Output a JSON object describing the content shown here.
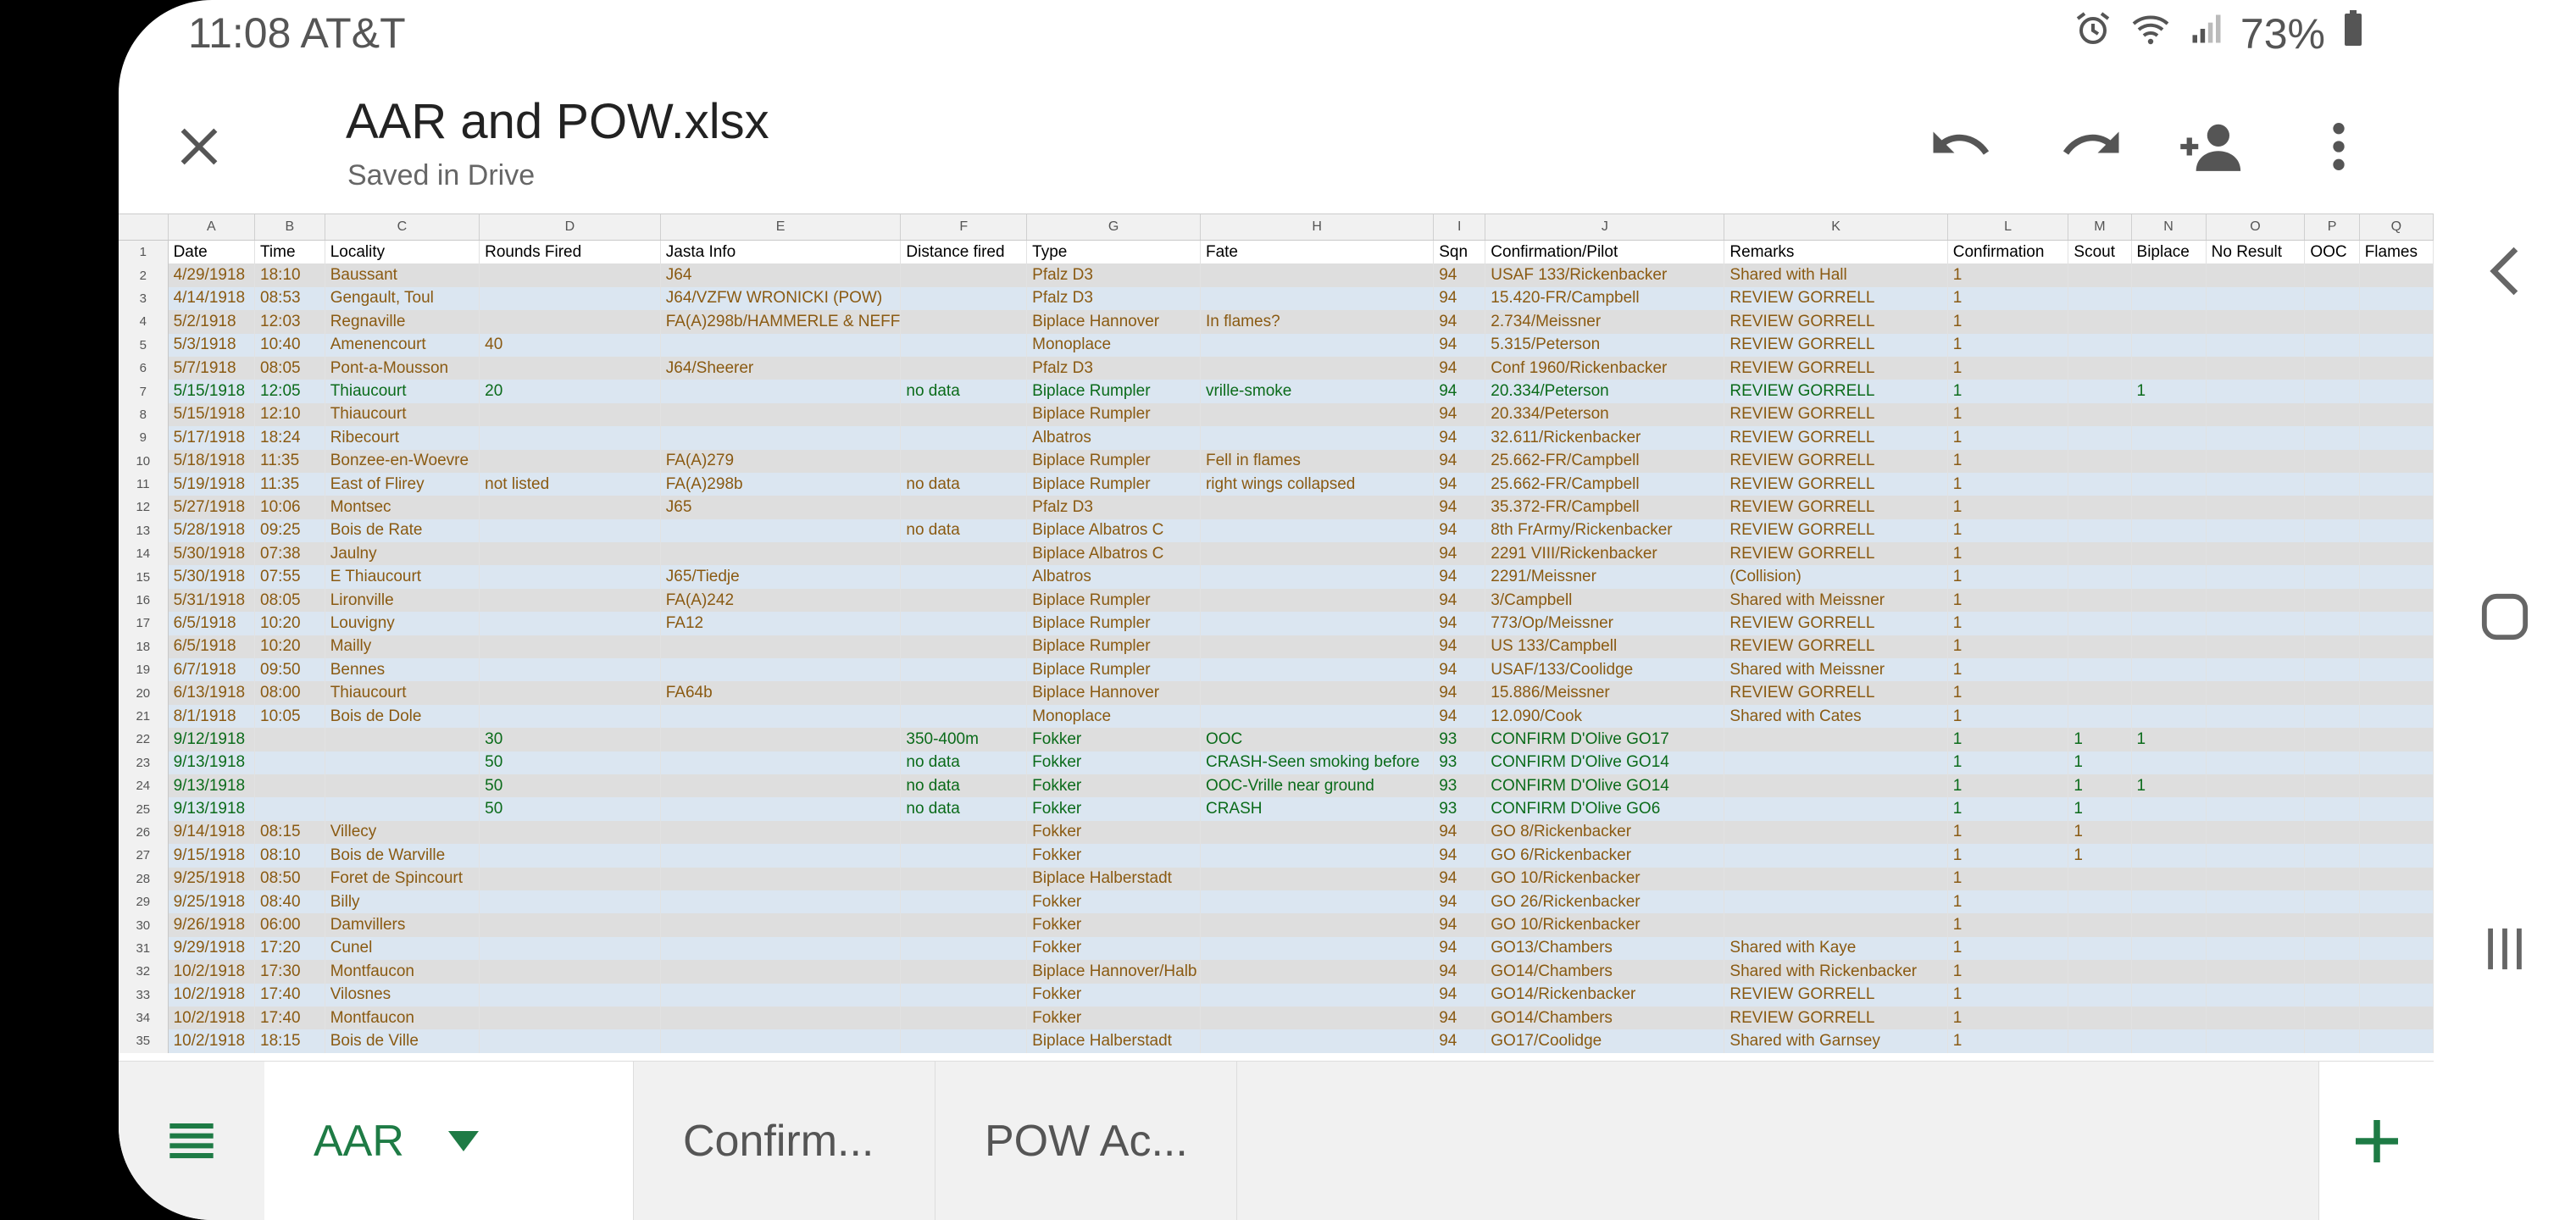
{
  "status_bar": {
    "time": "11:08 AT&T",
    "battery": "73%",
    "icons": [
      "alarm-icon",
      "wifi-icon",
      "signal-icon",
      "battery-icon"
    ]
  },
  "app_bar": {
    "title": "AAR and POW.xlsx",
    "subtitle": "Saved in Drive",
    "icons": [
      "close-icon",
      "undo-icon",
      "redo-icon",
      "share-add-person-icon",
      "more-vert-icon"
    ]
  },
  "colors": {
    "accent_green": "#1e7b45",
    "text_brown": "#8a5a12",
    "text_green": "#0b6b1a",
    "row_gray": "#dedede",
    "row_blue": "#dbe6f1"
  },
  "sheet": {
    "column_letters": [
      "A",
      "B",
      "C",
      "D",
      "E",
      "F",
      "G",
      "H",
      "I",
      "J",
      "K",
      "L",
      "M",
      "N",
      "O",
      "P",
      "Q"
    ],
    "header_row": {
      "number": "1",
      "cells": [
        "Date",
        "Time",
        "Locality",
        "Rounds Fired",
        "Jasta Info",
        "Distance fired",
        "Type",
        "Fate",
        "Sqn",
        "Confirmation/Pilot",
        "Remarks",
        "Confirmation",
        "Scout",
        "Biplace",
        "No Result",
        "OOC",
        "Flames"
      ]
    },
    "rows": [
      {
        "n": "2",
        "style": "gray",
        "color": "brown",
        "cells": [
          "4/29/1918",
          "18:10",
          "Baussant",
          "",
          "J64",
          "",
          "Pfalz D3",
          "",
          "94",
          "USAF 133/Rickenbacker",
          "Shared with Hall",
          "1",
          "",
          "",
          "",
          "",
          ""
        ]
      },
      {
        "n": "3",
        "style": "blue",
        "color": "brown",
        "cells": [
          "4/14/1918",
          "08:53",
          "Gengault, Toul",
          "",
          "J64/VZFW WRONICKI (POW)",
          "",
          "Pfalz D3",
          "",
          "94",
          "15.420-FR/Campbell",
          "REVIEW GORRELL",
          "1",
          "",
          "",
          "",
          "",
          ""
        ]
      },
      {
        "n": "4",
        "style": "gray",
        "color": "brown",
        "cells": [
          "5/2/1918",
          "12:03",
          "Regnaville",
          "",
          "FA(A)298b/HAMMERLE & NEFF",
          "",
          "Biplace Hannover",
          "In flames?",
          "94",
          "2.734/Meissner",
          "REVIEW GORRELL",
          "1",
          "",
          "",
          "",
          "",
          ""
        ]
      },
      {
        "n": "5",
        "style": "blue",
        "color": "brown",
        "cells": [
          "5/3/1918",
          "10:40",
          "Amenencourt",
          "40",
          "",
          "",
          "Monoplace",
          "",
          "94",
          "5.315/Peterson",
          "REVIEW GORRELL",
          "1",
          "",
          "",
          "",
          "",
          ""
        ]
      },
      {
        "n": "6",
        "style": "gray",
        "color": "brown",
        "cells": [
          "5/7/1918",
          "08:05",
          "Pont-a-Mousson",
          "",
          "J64/Sheerer",
          "",
          "Pfalz D3",
          "",
          "94",
          "Conf 1960/Rickenbacker",
          "REVIEW GORRELL",
          "1",
          "",
          "",
          "",
          "",
          ""
        ]
      },
      {
        "n": "7",
        "style": "blue",
        "color": "green",
        "cells": [
          "5/15/1918",
          "12:05",
          "Thiaucourt",
          "20",
          "",
          "no data",
          "Biplace Rumpler",
          "vrille-smoke",
          "94",
          "20.334/Peterson",
          "REVIEW GORRELL",
          "1",
          "",
          "1",
          "",
          "",
          ""
        ]
      },
      {
        "n": "8",
        "style": "gray",
        "color": "brown",
        "cells": [
          "5/15/1918",
          "12:10",
          "Thiaucourt",
          "",
          "",
          "",
          "Biplace Rumpler",
          "",
          "94",
          "20.334/Peterson",
          "REVIEW GORRELL",
          "1",
          "",
          "",
          "",
          "",
          ""
        ]
      },
      {
        "n": "9",
        "style": "blue",
        "color": "brown",
        "cells": [
          "5/17/1918",
          "18:24",
          "Ribecourt",
          "",
          "",
          "",
          "Albatros",
          "",
          "94",
          "32.611/Rickenbacker",
          "REVIEW GORRELL",
          "1",
          "",
          "",
          "",
          "",
          ""
        ]
      },
      {
        "n": "10",
        "style": "gray",
        "color": "brown",
        "cells": [
          "5/18/1918",
          "11:35",
          "Bonzee-en-Woevre",
          "",
          "FA(A)279",
          "",
          "Biplace Rumpler",
          "Fell in flames",
          "94",
          "25.662-FR/Campbell",
          "REVIEW GORRELL",
          "1",
          "",
          "",
          "",
          "",
          ""
        ]
      },
      {
        "n": "11",
        "style": "blue",
        "color": "brown",
        "cells": [
          "5/19/1918",
          "11:35",
          "East of Flirey",
          "not listed",
          "FA(A)298b",
          "no data",
          "Biplace Rumpler",
          "right wings collapsed",
          "94",
          "25.662-FR/Campbell",
          "REVIEW GORRELL",
          "1",
          "",
          "",
          "",
          "",
          ""
        ]
      },
      {
        "n": "12",
        "style": "gray",
        "color": "brown",
        "cells": [
          "5/27/1918",
          "10:06",
          "Montsec",
          "",
          "J65",
          "",
          "Pfalz D3",
          "",
          "94",
          "35.372-FR/Campbell",
          "REVIEW GORRELL",
          "1",
          "",
          "",
          "",
          "",
          ""
        ]
      },
      {
        "n": "13",
        "style": "blue",
        "color": "brown",
        "cells": [
          "5/28/1918",
          "09:25",
          "Bois de Rate",
          "",
          "",
          "no data",
          "Biplace Albatros C",
          "",
          "94",
          "8th FrArmy/Rickenbacker",
          "REVIEW GORRELL",
          "1",
          "",
          "",
          "",
          "",
          ""
        ]
      },
      {
        "n": "14",
        "style": "gray",
        "color": "brown",
        "cells": [
          "5/30/1918",
          "07:38",
          "Jaulny",
          "",
          "",
          "",
          "Biplace Albatros C",
          "",
          "94",
          "2291 VIII/Rickenbacker",
          "REVIEW GORRELL",
          "1",
          "",
          "",
          "",
          "",
          ""
        ]
      },
      {
        "n": "15",
        "style": "blue",
        "color": "brown",
        "cells": [
          "5/30/1918",
          "07:55",
          "E Thiaucourt",
          "",
          "J65/Tiedje",
          "",
          "Albatros",
          "",
          "94",
          "2291/Meissner",
          "(Collision)",
          "1",
          "",
          "",
          "",
          "",
          ""
        ]
      },
      {
        "n": "16",
        "style": "gray",
        "color": "brown",
        "cells": [
          "5/31/1918",
          "08:05",
          "Lironville",
          "",
          "FA(A)242",
          "",
          "Biplace Rumpler",
          "",
          "94",
          "3/Campbell",
          "Shared with Meissner",
          "1",
          "",
          "",
          "",
          "",
          ""
        ]
      },
      {
        "n": "17",
        "style": "blue",
        "color": "brown",
        "cells": [
          "6/5/1918",
          "10:20",
          "Louvigny",
          "",
          "FA12",
          "",
          "Biplace Rumpler",
          "",
          "94",
          "773/Op/Meissner",
          "REVIEW GORRELL",
          "1",
          "",
          "",
          "",
          "",
          ""
        ]
      },
      {
        "n": "18",
        "style": "gray",
        "color": "brown",
        "cells": [
          "6/5/1918",
          "10:20",
          "Mailly",
          "",
          "",
          "",
          "Biplace Rumpler",
          "",
          "94",
          "US 133/Campbell",
          "REVIEW GORRELL",
          "1",
          "",
          "",
          "",
          "",
          ""
        ]
      },
      {
        "n": "19",
        "style": "blue",
        "color": "brown",
        "cells": [
          "6/7/1918",
          "09:50",
          "Bennes",
          "",
          "",
          "",
          "Biplace Rumpler",
          "",
          "94",
          "USAF/133/Coolidge",
          "Shared with Meissner",
          "1",
          "",
          "",
          "",
          "",
          ""
        ]
      },
      {
        "n": "20",
        "style": "gray",
        "color": "brown",
        "cells": [
          "6/13/1918",
          "08:00",
          "Thiaucourt",
          "",
          "FA64b",
          "",
          "Biplace Hannover",
          "",
          "94",
          "15.886/Meissner",
          "REVIEW GORRELL",
          "1",
          "",
          "",
          "",
          "",
          ""
        ]
      },
      {
        "n": "21",
        "style": "blue",
        "color": "brown",
        "cells": [
          "8/1/1918",
          "10:05",
          "Bois de Dole",
          "",
          "",
          "",
          "Monoplace",
          "",
          "94",
          "12.090/Cook",
          "Shared with Cates",
          "1",
          "",
          "",
          "",
          "",
          ""
        ]
      },
      {
        "n": "22",
        "style": "gray",
        "color": "green",
        "cells": [
          "9/12/1918",
          "",
          "",
          "30",
          "",
          "350-400m",
          "Fokker",
          "OOC",
          "93",
          "CONFIRM D'Olive GO17",
          "",
          "1",
          "1",
          "1",
          "",
          "",
          ""
        ]
      },
      {
        "n": "23",
        "style": "blue",
        "color": "green",
        "cells": [
          "9/13/1918",
          "",
          "",
          "50",
          "",
          "no data",
          "Fokker",
          "CRASH-Seen smoking before",
          "93",
          "CONFIRM D'Olive GO14",
          "",
          "1",
          "1",
          "",
          "",
          "",
          ""
        ]
      },
      {
        "n": "24",
        "style": "gray",
        "color": "green",
        "cells": [
          "9/13/1918",
          "",
          "",
          "50",
          "",
          "no data",
          "Fokker",
          "OOC-Vrille near ground",
          "93",
          "CONFIRM D'Olive GO14",
          "",
          "1",
          "1",
          "1",
          "",
          "",
          ""
        ]
      },
      {
        "n": "25",
        "style": "blue",
        "color": "green",
        "cells": [
          "9/13/1918",
          "",
          "",
          "50",
          "",
          "no data",
          "Fokker",
          "CRASH",
          "93",
          "CONFIRM D'Olive GO6",
          "",
          "1",
          "1",
          "",
          "",
          "",
          ""
        ]
      },
      {
        "n": "26",
        "style": "gray",
        "color": "brown",
        "cells": [
          "9/14/1918",
          "08:15",
          "Villecy",
          "",
          "",
          "",
          "Fokker",
          "",
          "94",
          "GO 8/Rickenbacker",
          "",
          "1",
          "1",
          "",
          "",
          "",
          ""
        ]
      },
      {
        "n": "27",
        "style": "blue",
        "color": "brown",
        "cells": [
          "9/15/1918",
          "08:10",
          "Bois de Warville",
          "",
          "",
          "",
          "Fokker",
          "",
          "94",
          "GO 6/Rickenbacker",
          "",
          "1",
          "1",
          "",
          "",
          "",
          ""
        ]
      },
      {
        "n": "28",
        "style": "gray",
        "color": "brown",
        "cells": [
          "9/25/1918",
          "08:50",
          "Foret de Spincourt",
          "",
          "",
          "",
          "Biplace Halberstadt",
          "",
          "94",
          "GO 10/Rickenbacker",
          "",
          "1",
          "",
          "",
          "",
          "",
          ""
        ]
      },
      {
        "n": "29",
        "style": "blue",
        "color": "brown",
        "cells": [
          "9/25/1918",
          "08:40",
          "Billy",
          "",
          "",
          "",
          "Fokker",
          "",
          "94",
          "GO 26/Rickenbacker",
          "",
          "1",
          "",
          "",
          "",
          "",
          ""
        ]
      },
      {
        "n": "30",
        "style": "gray",
        "color": "brown",
        "cells": [
          "9/26/1918",
          "06:00",
          "Damvillers",
          "",
          "",
          "",
          "Fokker",
          "",
          "94",
          "GO 10/Rickenbacker",
          "",
          "1",
          "",
          "",
          "",
          "",
          ""
        ]
      },
      {
        "n": "31",
        "style": "blue",
        "color": "brown",
        "cells": [
          "9/29/1918",
          "17:20",
          "Cunel",
          "",
          "",
          "",
          "Fokker",
          "",
          "94",
          "GO13/Chambers",
          "Shared with Kaye",
          "1",
          "",
          "",
          "",
          "",
          ""
        ]
      },
      {
        "n": "32",
        "style": "gray",
        "color": "brown",
        "cells": [
          "10/2/1918",
          "17:30",
          "Montfaucon",
          "",
          "",
          "",
          "Biplace Hannover/Halb",
          "",
          "94",
          "GO14/Chambers",
          "Shared with Rickenbacker",
          "1",
          "",
          "",
          "",
          "",
          ""
        ]
      },
      {
        "n": "33",
        "style": "blue",
        "color": "brown",
        "cells": [
          "10/2/1918",
          "17:40",
          "Vilosnes",
          "",
          "",
          "",
          "Fokker",
          "",
          "94",
          "GO14/Rickenbacker",
          "REVIEW GORRELL",
          "1",
          "",
          "",
          "",
          "",
          ""
        ]
      },
      {
        "n": "34",
        "style": "gray",
        "color": "brown",
        "cells": [
          "10/2/1918",
          "17:40",
          "Montfaucon",
          "",
          "",
          "",
          "Fokker",
          "",
          "94",
          "GO14/Chambers",
          "REVIEW GORRELL",
          "1",
          "",
          "",
          "",
          "",
          ""
        ]
      },
      {
        "n": "35",
        "style": "blue",
        "color": "brown",
        "cells": [
          "10/2/1918",
          "18:15",
          "Bois de Ville",
          "",
          "",
          "",
          "Biplace Halberstadt",
          "",
          "94",
          "GO17/Coolidge",
          "Shared with Garnsey",
          "1",
          "",
          "",
          "",
          "",
          ""
        ]
      }
    ]
  },
  "tabs": {
    "items": [
      {
        "label": "AAR"
      },
      {
        "label": "Confirm..."
      },
      {
        "label": "POW Ac..."
      }
    ],
    "icons": [
      "all-sheets-icon",
      "dropdown-arrow-icon",
      "add-sheet-icon"
    ]
  },
  "nav_bar": {
    "icons": [
      "back-icon",
      "home-icon",
      "recent-apps-icon"
    ]
  }
}
